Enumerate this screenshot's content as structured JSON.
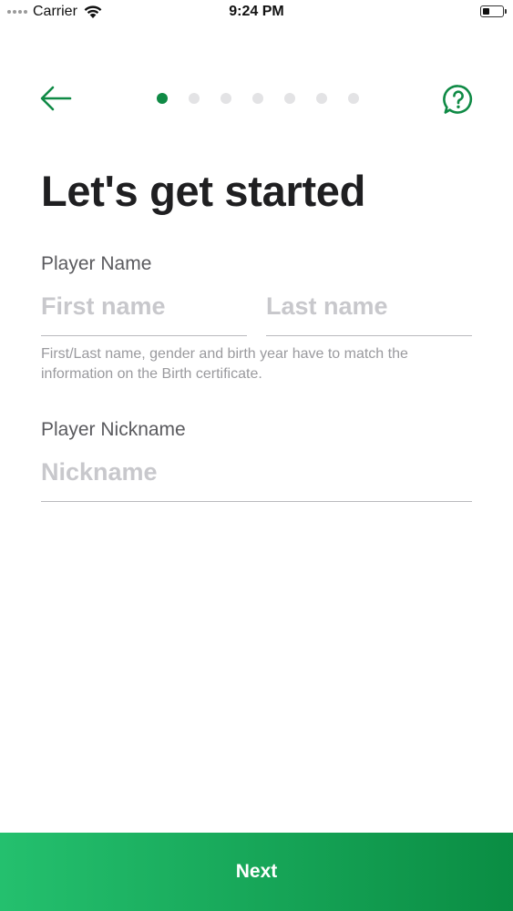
{
  "status_bar": {
    "carrier": "Carrier",
    "time": "9:24 PM",
    "battery_level": 0.35
  },
  "header": {
    "back_icon": "arrow-left-icon",
    "help_icon": "help-chat-icon",
    "steps_total": 7,
    "step_current": 1
  },
  "colors": {
    "accent": "#0f8a45",
    "gradient_start": "#24c06e",
    "gradient_end": "#0a8d43",
    "dot_inactive": "#e3e3e5"
  },
  "title": "Let's get started",
  "form": {
    "player_name_label": "Player Name",
    "first_name": {
      "value": "",
      "placeholder": "First name"
    },
    "last_name": {
      "value": "",
      "placeholder": "Last name"
    },
    "helper_text": "First/Last name, gender and birth year have to match the information on the Birth certificate.",
    "nickname_label": "Player Nickname",
    "nickname": {
      "value": "",
      "placeholder": "Nickname"
    }
  },
  "footer": {
    "next_label": "Next"
  }
}
